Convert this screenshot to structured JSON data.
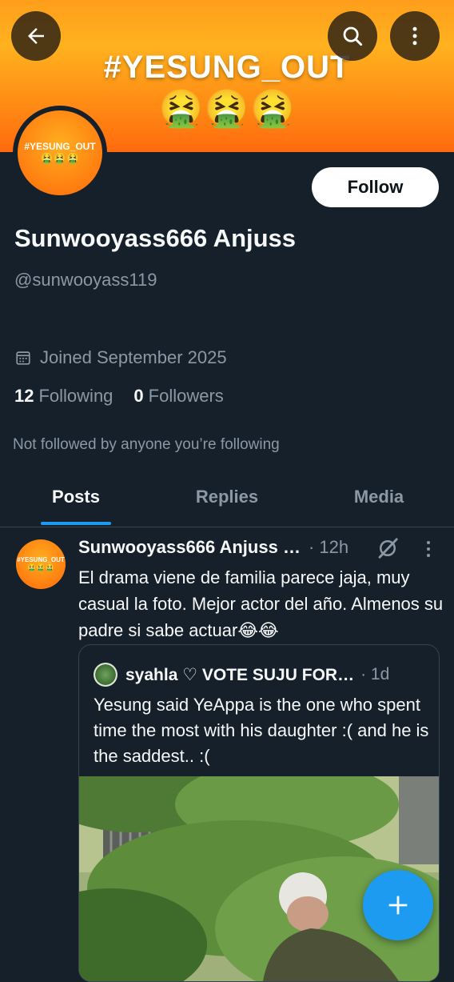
{
  "header": {
    "banner_text": "#YESUNG_OUT",
    "banner_emojis": "🤮🤮🤮",
    "back_icon": "arrow-left-icon",
    "search_icon": "search-icon",
    "more_icon": "more-vertical-icon"
  },
  "profile": {
    "avatar_text": "#YESUNG_OUT",
    "avatar_emojis": "🤮🤮🤮",
    "follow_label": "Follow",
    "display_name": "Sunwooyass666 Anjuss",
    "handle": "@sunwooyass119",
    "joined": "Joined September 2025",
    "following_count": "12",
    "following_label": "Following",
    "followers_count": "0",
    "followers_label": "Followers",
    "not_followed": "Not followed by anyone you’re following"
  },
  "tabs": [
    {
      "label": "Posts",
      "active": true
    },
    {
      "label": "Replies",
      "active": false
    },
    {
      "label": "Media",
      "active": false
    }
  ],
  "post": {
    "author": "Sunwooyass666 Anjuss …",
    "time": "· 12h",
    "avatar_text": "#YESUNG_OUT",
    "avatar_emojis": "🤮🤮🤮",
    "text": "El drama viene de familia parece jaja, muy casual la foto. Mejor actor del año. Almenos su padre si sabe actuar😂😂",
    "quote": {
      "author": "syahla ♡ VOTE SUJU FOR…",
      "time": "· 1d",
      "text": "Yesung said YeAppa is the one who spent time the most with his daughter :( and he is the saddest.. :("
    }
  },
  "fab": {
    "icon": "plus-icon"
  },
  "colors": {
    "background": "#15202b",
    "accent": "#1d9bf0",
    "muted_text": "#8b98a5",
    "banner_orange": "#ff8a14"
  }
}
